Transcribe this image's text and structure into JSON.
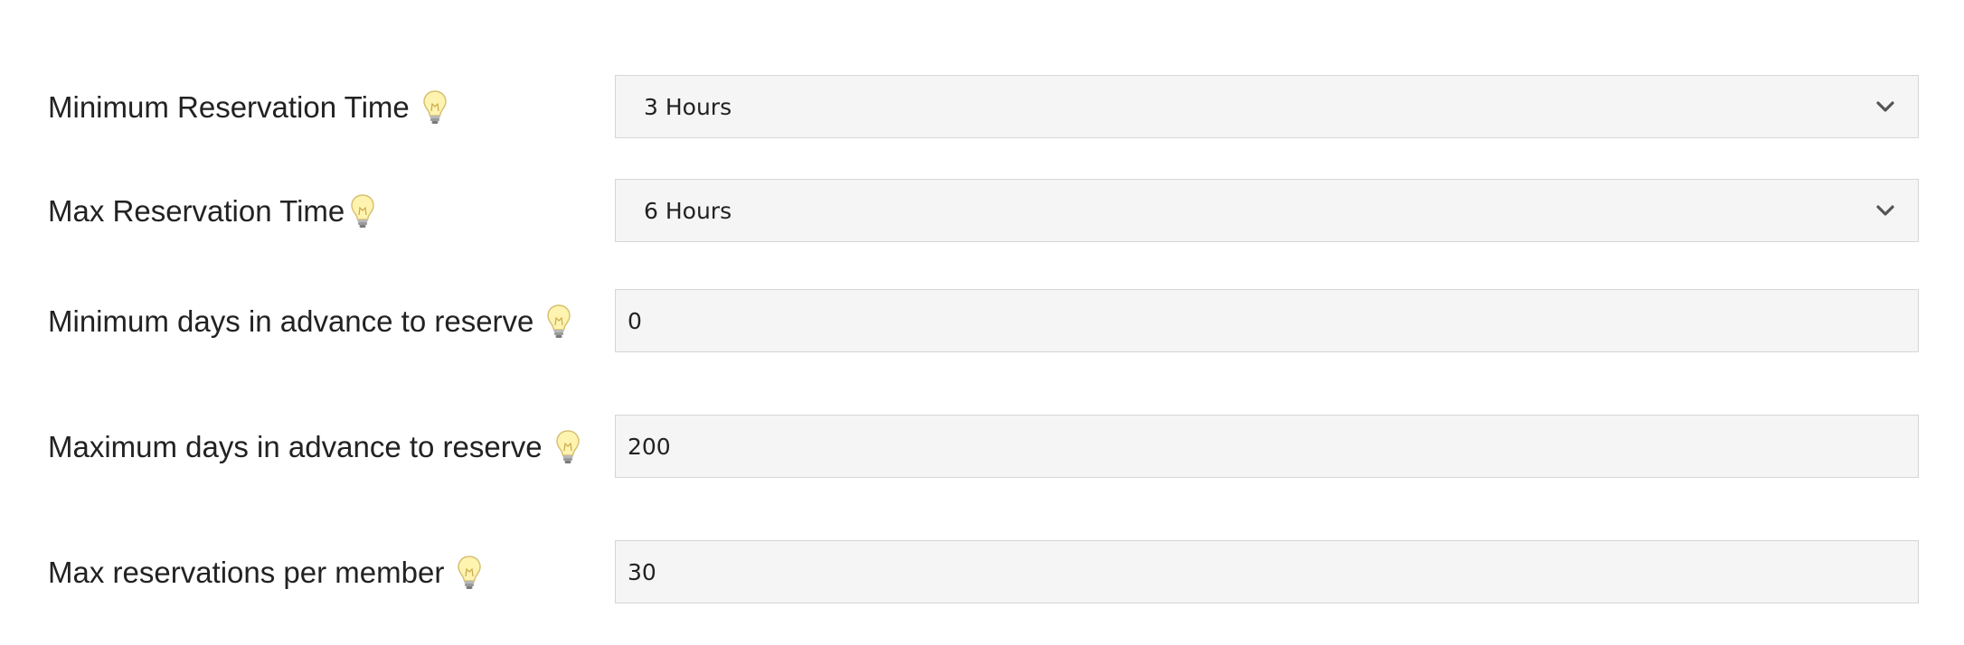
{
  "form": {
    "rows": [
      {
        "label": "Minimum Reservation Time",
        "type": "select",
        "value": "3 Hours",
        "icon": "lightbulb-icon"
      },
      {
        "label": "Max Reservation Time",
        "type": "select",
        "value": "6 Hours",
        "icon": "lightbulb-icon"
      },
      {
        "label": "Minimum days in advance to reserve",
        "type": "input",
        "value": "0",
        "icon": "lightbulb-icon"
      },
      {
        "label": "Maximum days in advance to reserve",
        "type": "input",
        "value": "200",
        "icon": "lightbulb-icon"
      },
      {
        "label": "Max reservations per member",
        "type": "input",
        "value": "30",
        "icon": "lightbulb-icon"
      }
    ]
  },
  "colors": {
    "field_background": "#f5f5f5",
    "field_border": "#d6d6d6",
    "text": "#222222",
    "chevron": "#555555",
    "bulb": "#fff3b0"
  }
}
